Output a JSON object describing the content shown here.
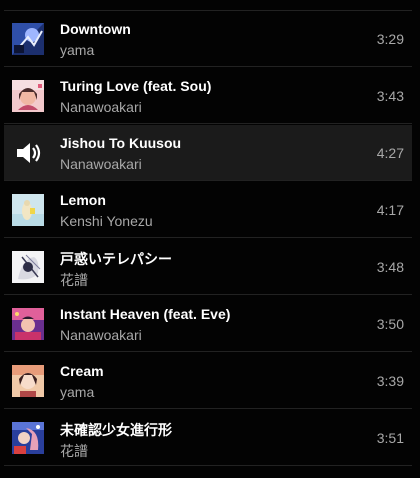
{
  "playlist": {
    "tracks": [
      {
        "title": "Downtown",
        "artist": "yama",
        "duration": "3:29",
        "art": "downtown-art",
        "playing": false
      },
      {
        "title": "Turing Love (feat. Sou)",
        "artist": "Nanawoakari",
        "duration": "3:43",
        "art": "turing-love-art",
        "playing": false
      },
      {
        "title": "Jishou To Kuusou",
        "artist": "Nanawoakari",
        "duration": "4:27",
        "art": "speaker-icon",
        "playing": true
      },
      {
        "title": "Lemon",
        "artist": "Kenshi Yonezu",
        "duration": "4:17",
        "art": "lemon-art",
        "playing": false
      },
      {
        "title": "戸惑いテレパシー",
        "artist": "花譜",
        "duration": "3:48",
        "art": "tomadoi-art",
        "playing": false
      },
      {
        "title": "Instant Heaven (feat. Eve)",
        "artist": "Nanawoakari",
        "duration": "3:50",
        "art": "instant-heaven-art",
        "playing": false
      },
      {
        "title": "Cream",
        "artist": "yama",
        "duration": "3:39",
        "art": "cream-art",
        "playing": false
      },
      {
        "title": "未確認少女進行形",
        "artist": "花譜",
        "duration": "3:51",
        "art": "mikakunin-art",
        "playing": false
      }
    ]
  },
  "colors": {
    "background": "#030303",
    "playing_row": "#1b1b1b",
    "title": "#ffffff",
    "secondary": "#a8a8a8"
  }
}
